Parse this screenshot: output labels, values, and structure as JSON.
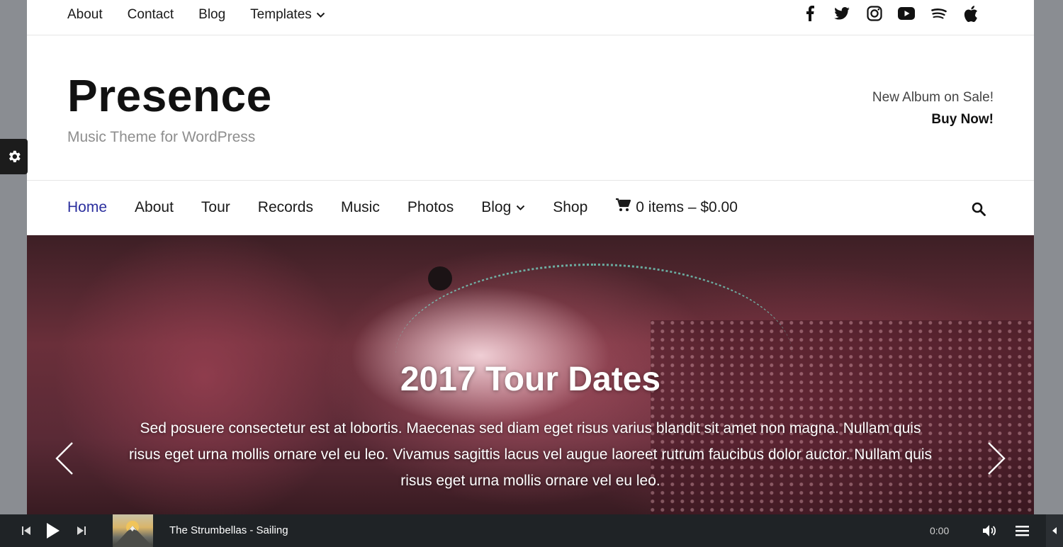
{
  "topnav": {
    "items": [
      "About",
      "Contact",
      "Blog",
      "Templates"
    ]
  },
  "social": [
    "facebook-icon",
    "twitter-icon",
    "instagram-icon",
    "youtube-icon",
    "spotify-icon",
    "apple-icon"
  ],
  "brand": {
    "title": "Presence",
    "tagline": "Music Theme for WordPress"
  },
  "promo": {
    "line": "New Album on Sale!",
    "link": "Buy Now!"
  },
  "mainnav": {
    "items": [
      "Home",
      "About",
      "Tour",
      "Records",
      "Music",
      "Photos",
      "Blog",
      "Shop"
    ],
    "cart": "0 items – $0.00",
    "active_color": "#2b2f9e"
  },
  "hero": {
    "title": "2017 Tour Dates",
    "text": "Sed posuere consectetur est at lobortis. Maecenas sed diam eget risus varius blandit sit amet non magna. Nullam quis risus eget urna mollis ornare vel eu leo. Vivamus sagittis lacus vel augue laoreet rutrum faucibus dolor auctor. Nullam quis risus eget urna mollis ornare vel eu leo."
  },
  "player": {
    "track": "The Strumbellas - Sailing",
    "time": "0:00"
  }
}
